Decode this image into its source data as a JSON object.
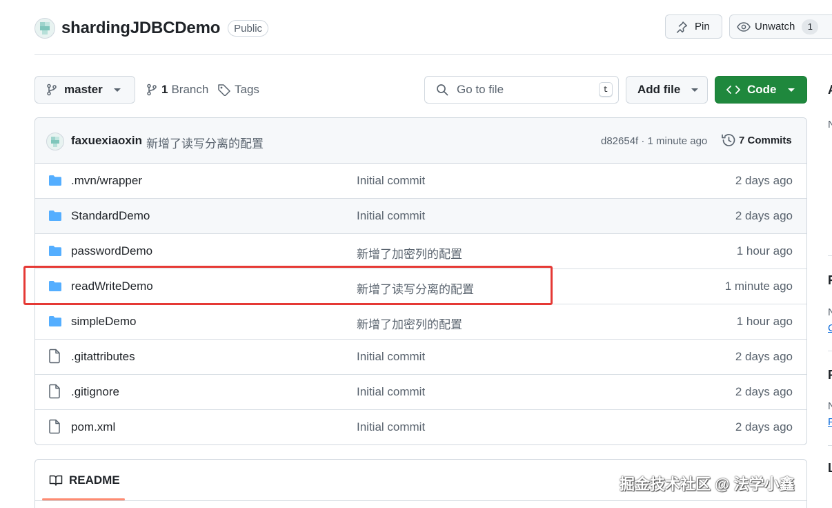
{
  "repo": {
    "name": "shardingJDBCDemo",
    "visibility": "Public"
  },
  "header_actions": {
    "pin_label": "Pin",
    "watch_label": "Unwatch",
    "watch_count": "1"
  },
  "toolbar": {
    "branch_name": "master",
    "branches_count": "1",
    "branches_label": "Branch",
    "tags_label": "Tags",
    "search_placeholder": "Go to file",
    "search_shortcut": "t",
    "add_file_label": "Add file",
    "code_label": "Code"
  },
  "latest_commit": {
    "author": "faxuexiaoxin",
    "message": "新增了读写分离的配置",
    "meta": "d82654f · 1 minute ago",
    "commits_label": "7 Commits"
  },
  "files": [
    {
      "type": "folder",
      "name": ".mvn/wrapper",
      "message": "Initial commit",
      "date": "2 days ago"
    },
    {
      "type": "folder",
      "name": "StandardDemo",
      "message": "Initial commit",
      "date": "2 days ago"
    },
    {
      "type": "folder",
      "name": "passwordDemo",
      "message": "新增了加密列的配置",
      "date": "1 hour ago"
    },
    {
      "type": "folder",
      "name": "readWriteDemo",
      "message": "新增了读写分离的配置",
      "date": "1 minute ago"
    },
    {
      "type": "folder",
      "name": "simpleDemo",
      "message": "新增了加密列的配置",
      "date": "1 hour ago"
    },
    {
      "type": "file",
      "name": ".gitattributes",
      "message": "Initial commit",
      "date": "2 days ago"
    },
    {
      "type": "file",
      "name": ".gitignore",
      "message": "Initial commit",
      "date": "2 days ago"
    },
    {
      "type": "file",
      "name": "pom.xml",
      "message": "Initial commit",
      "date": "2 days ago"
    }
  ],
  "readme": {
    "tab_label": "README"
  },
  "sidebar_cropped": {
    "about_initial": "A",
    "desc_initial": "N",
    "releases_initial": "R",
    "releases_note_initial": "N",
    "releases_link_initial": "C",
    "packages_initial": "P",
    "packages_note_initial": "N",
    "packages_link_initial": "P",
    "languages_initial": "L"
  },
  "watermark": "掘金技术社区 @ 法学小鑫",
  "colors": {
    "primary_green": "#1f883d",
    "folder_blue": "#54aeff",
    "highlight_red": "#e53935",
    "readme_underline": "#fd8c73"
  },
  "icons": {
    "folder": "folder-icon",
    "file": "file-icon",
    "branch": "git-branch-icon",
    "tag": "tag-icon",
    "search": "search-icon",
    "pin": "pin-icon",
    "eye": "eye-icon",
    "history": "history-icon",
    "code": "code-icon",
    "book": "book-icon"
  }
}
